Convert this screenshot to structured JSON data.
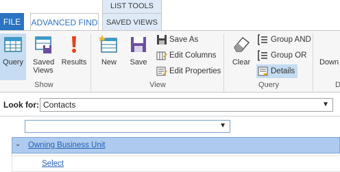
{
  "tabs": {
    "file": "FILE",
    "advanced_find": "ADVANCED FIND",
    "context_group": "LIST TOOLS",
    "saved_views": "SAVED VIEWS"
  },
  "ribbon": {
    "show_group": {
      "label": "Show",
      "query": "Query",
      "saved_views": "Saved Views",
      "results": "Results"
    },
    "view_group": {
      "label": "View",
      "new": "New",
      "save": "Save",
      "save_as": "Save As",
      "edit_columns": "Edit Columns",
      "edit_properties": "Edit Properties"
    },
    "query_group": {
      "label": "Query",
      "clear": "Clear",
      "group_and": "Group AND",
      "group_or": "Group OR",
      "details": "Details"
    },
    "partial": {
      "download": "Down",
      "group_label": "D"
    }
  },
  "lookfor": {
    "label": "Look for:",
    "value": "Contacts"
  },
  "criteria": {
    "field_select_value": "",
    "owning_business_unit": "Owning Business Unit",
    "select_link": "Select"
  },
  "colors": {
    "accent": "#2a74c2",
    "selected": "#c5dcf2",
    "row_highlight": "#aecbef"
  }
}
